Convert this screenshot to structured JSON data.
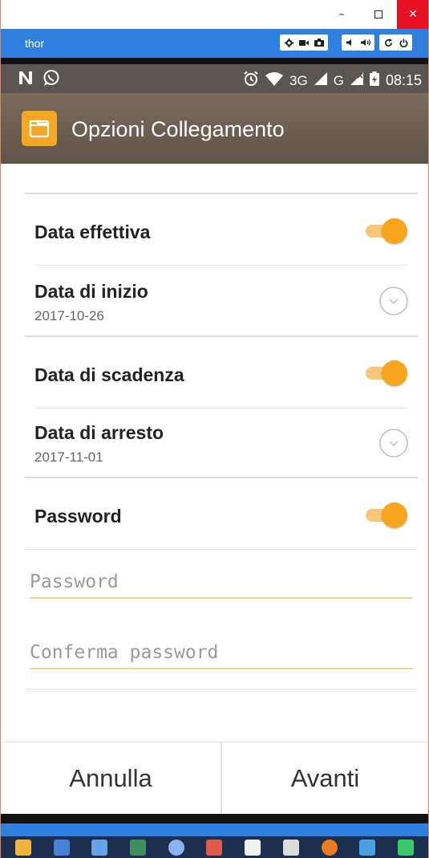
{
  "window": {
    "minimize_glyph": "–",
    "close_glyph": "✕"
  },
  "emulator": {
    "name": "thor",
    "tools": [
      "settings-icon",
      "video-icon",
      "camera-icon",
      "volume-down-icon",
      "volume-up-icon",
      "rotate-icon",
      "power-icon"
    ]
  },
  "status_bar": {
    "network": "3G",
    "network2": "G",
    "time": "08:15"
  },
  "app_bar": {
    "title": "Opzioni Collegamento",
    "icon": "folder-icon"
  },
  "rows": {
    "effective": {
      "label": "Data effettiva",
      "enabled": true
    },
    "start": {
      "label": "Data di inizio",
      "value": "2017-10-26"
    },
    "expiry": {
      "label": "Data di scadenza",
      "enabled": true
    },
    "stop": {
      "label": "Data di arresto",
      "value": "2017-11-01"
    },
    "password": {
      "label": "Password",
      "enabled": true
    }
  },
  "fields": {
    "password_placeholder": "Password",
    "confirm_placeholder": "Conferma password"
  },
  "buttons": {
    "cancel": "Annulla",
    "next": "Avanti"
  },
  "colors": {
    "accent": "#f7a51c",
    "appbar": "#6b5e50",
    "emulator_bar": "#2f7fe0",
    "close": "#e81123"
  }
}
